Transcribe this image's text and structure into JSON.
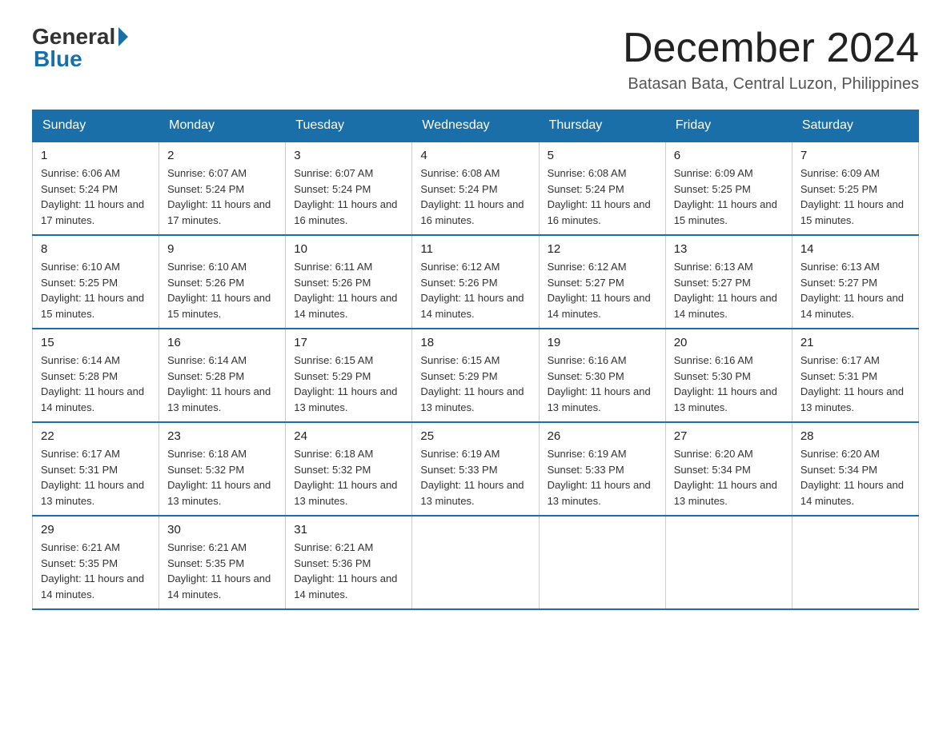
{
  "header": {
    "logo_general": "General",
    "logo_blue": "Blue",
    "month_title": "December 2024",
    "subtitle": "Batasan Bata, Central Luzon, Philippines"
  },
  "days_of_week": [
    "Sunday",
    "Monday",
    "Tuesday",
    "Wednesday",
    "Thursday",
    "Friday",
    "Saturday"
  ],
  "weeks": [
    [
      {
        "day": "1",
        "sunrise": "6:06 AM",
        "sunset": "5:24 PM",
        "daylight": "11 hours and 17 minutes."
      },
      {
        "day": "2",
        "sunrise": "6:07 AM",
        "sunset": "5:24 PM",
        "daylight": "11 hours and 17 minutes."
      },
      {
        "day": "3",
        "sunrise": "6:07 AM",
        "sunset": "5:24 PM",
        "daylight": "11 hours and 16 minutes."
      },
      {
        "day": "4",
        "sunrise": "6:08 AM",
        "sunset": "5:24 PM",
        "daylight": "11 hours and 16 minutes."
      },
      {
        "day": "5",
        "sunrise": "6:08 AM",
        "sunset": "5:24 PM",
        "daylight": "11 hours and 16 minutes."
      },
      {
        "day": "6",
        "sunrise": "6:09 AM",
        "sunset": "5:25 PM",
        "daylight": "11 hours and 15 minutes."
      },
      {
        "day": "7",
        "sunrise": "6:09 AM",
        "sunset": "5:25 PM",
        "daylight": "11 hours and 15 minutes."
      }
    ],
    [
      {
        "day": "8",
        "sunrise": "6:10 AM",
        "sunset": "5:25 PM",
        "daylight": "11 hours and 15 minutes."
      },
      {
        "day": "9",
        "sunrise": "6:10 AM",
        "sunset": "5:26 PM",
        "daylight": "11 hours and 15 minutes."
      },
      {
        "day": "10",
        "sunrise": "6:11 AM",
        "sunset": "5:26 PM",
        "daylight": "11 hours and 14 minutes."
      },
      {
        "day": "11",
        "sunrise": "6:12 AM",
        "sunset": "5:26 PM",
        "daylight": "11 hours and 14 minutes."
      },
      {
        "day": "12",
        "sunrise": "6:12 AM",
        "sunset": "5:27 PM",
        "daylight": "11 hours and 14 minutes."
      },
      {
        "day": "13",
        "sunrise": "6:13 AM",
        "sunset": "5:27 PM",
        "daylight": "11 hours and 14 minutes."
      },
      {
        "day": "14",
        "sunrise": "6:13 AM",
        "sunset": "5:27 PM",
        "daylight": "11 hours and 14 minutes."
      }
    ],
    [
      {
        "day": "15",
        "sunrise": "6:14 AM",
        "sunset": "5:28 PM",
        "daylight": "11 hours and 14 minutes."
      },
      {
        "day": "16",
        "sunrise": "6:14 AM",
        "sunset": "5:28 PM",
        "daylight": "11 hours and 13 minutes."
      },
      {
        "day": "17",
        "sunrise": "6:15 AM",
        "sunset": "5:29 PM",
        "daylight": "11 hours and 13 minutes."
      },
      {
        "day": "18",
        "sunrise": "6:15 AM",
        "sunset": "5:29 PM",
        "daylight": "11 hours and 13 minutes."
      },
      {
        "day": "19",
        "sunrise": "6:16 AM",
        "sunset": "5:30 PM",
        "daylight": "11 hours and 13 minutes."
      },
      {
        "day": "20",
        "sunrise": "6:16 AM",
        "sunset": "5:30 PM",
        "daylight": "11 hours and 13 minutes."
      },
      {
        "day": "21",
        "sunrise": "6:17 AM",
        "sunset": "5:31 PM",
        "daylight": "11 hours and 13 minutes."
      }
    ],
    [
      {
        "day": "22",
        "sunrise": "6:17 AM",
        "sunset": "5:31 PM",
        "daylight": "11 hours and 13 minutes."
      },
      {
        "day": "23",
        "sunrise": "6:18 AM",
        "sunset": "5:32 PM",
        "daylight": "11 hours and 13 minutes."
      },
      {
        "day": "24",
        "sunrise": "6:18 AM",
        "sunset": "5:32 PM",
        "daylight": "11 hours and 13 minutes."
      },
      {
        "day": "25",
        "sunrise": "6:19 AM",
        "sunset": "5:33 PM",
        "daylight": "11 hours and 13 minutes."
      },
      {
        "day": "26",
        "sunrise": "6:19 AM",
        "sunset": "5:33 PM",
        "daylight": "11 hours and 13 minutes."
      },
      {
        "day": "27",
        "sunrise": "6:20 AM",
        "sunset": "5:34 PM",
        "daylight": "11 hours and 13 minutes."
      },
      {
        "day": "28",
        "sunrise": "6:20 AM",
        "sunset": "5:34 PM",
        "daylight": "11 hours and 14 minutes."
      }
    ],
    [
      {
        "day": "29",
        "sunrise": "6:21 AM",
        "sunset": "5:35 PM",
        "daylight": "11 hours and 14 minutes."
      },
      {
        "day": "30",
        "sunrise": "6:21 AM",
        "sunset": "5:35 PM",
        "daylight": "11 hours and 14 minutes."
      },
      {
        "day": "31",
        "sunrise": "6:21 AM",
        "sunset": "5:36 PM",
        "daylight": "11 hours and 14 minutes."
      },
      null,
      null,
      null,
      null
    ]
  ]
}
